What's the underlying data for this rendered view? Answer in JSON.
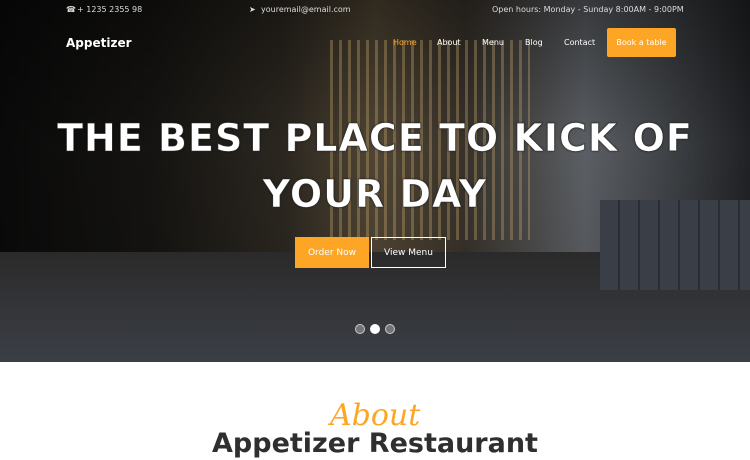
{
  "topbar": {
    "phone": "+ 1235 2355 98",
    "email": "youremail@email.com",
    "hours": "Open hours: Monday - Sunday 8:00AM - 9:00PM"
  },
  "nav": {
    "logo": "Appetizer",
    "items": [
      "Home",
      "About",
      "Menu",
      "Blog",
      "Contact"
    ],
    "active": "Home",
    "book": "Book a table"
  },
  "hero": {
    "title": "THE BEST PLACE TO KICK OF YOUR DAY",
    "order": "Order Now",
    "view": "View Menu",
    "slides": 3,
    "active_slide": 2
  },
  "about": {
    "script": "About",
    "title": "Appetizer Restaurant"
  },
  "colors": {
    "accent": "#fda625",
    "heading": "#2f2f2f"
  }
}
